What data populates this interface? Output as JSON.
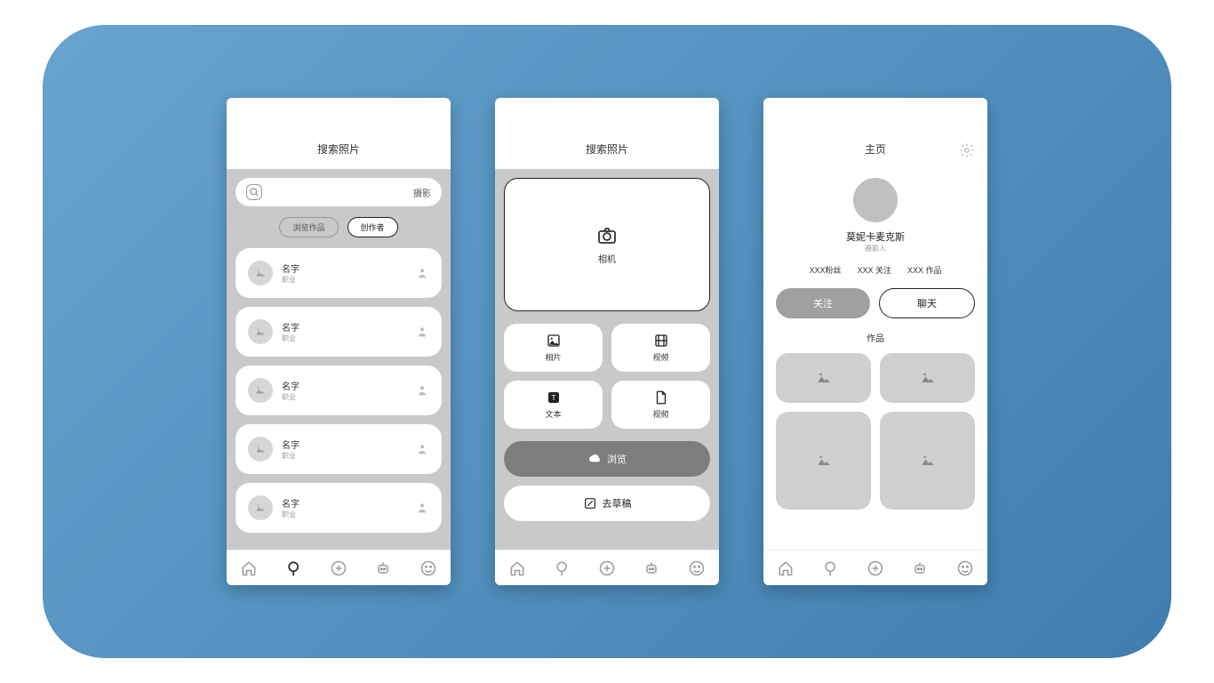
{
  "screen1": {
    "title": "搜索照片",
    "search_term": "摄影",
    "tabs": {
      "browse": "浏览作品",
      "creator": "创作者"
    },
    "cards": [
      {
        "name": "名字",
        "sub": "职业"
      },
      {
        "name": "名字",
        "sub": "职业"
      },
      {
        "name": "名字",
        "sub": "职业"
      },
      {
        "name": "名字",
        "sub": "职业"
      },
      {
        "name": "名字",
        "sub": "职业"
      }
    ]
  },
  "screen2": {
    "title": "搜索照片",
    "camera": "相机",
    "tools": {
      "photo": "相片",
      "video1": "视频",
      "text": "文本",
      "video2": "视频"
    },
    "browse": "浏览",
    "draft": "去草稿"
  },
  "screen3": {
    "title": "主页",
    "name": "莫妮卡麦克斯",
    "role": "摄影人",
    "stats": {
      "fans": "XXX粉丝",
      "follow": "XXX 关注",
      "works": "XXX 作品"
    },
    "actions": {
      "follow": "关注",
      "chat": "聊天"
    },
    "section": "作品"
  }
}
